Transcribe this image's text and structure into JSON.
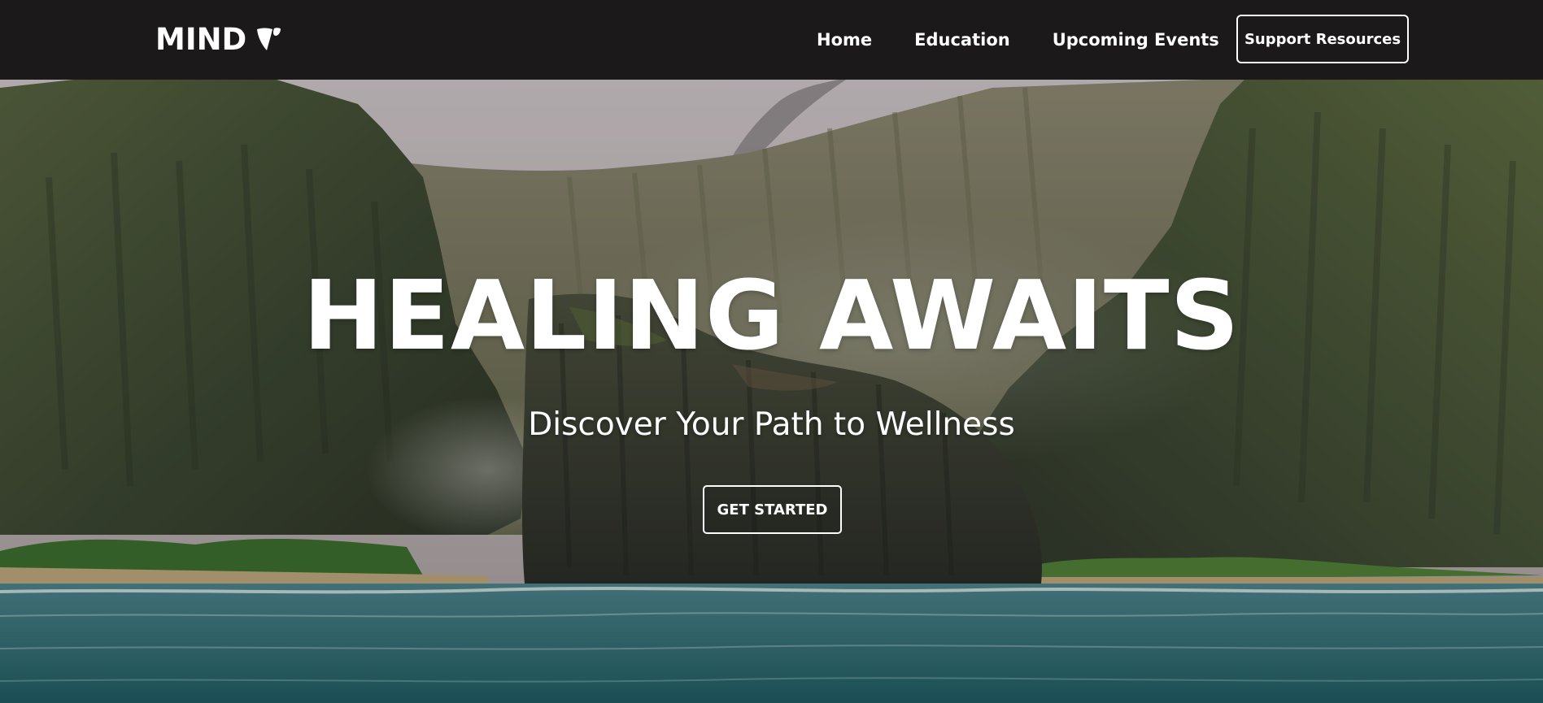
{
  "navbar": {
    "brand": {
      "text": "MIND",
      "icon": "typo3-logo-icon"
    },
    "links": [
      {
        "label": "Home"
      },
      {
        "label": "Education"
      },
      {
        "label": "Upcoming Events"
      }
    ],
    "cta_label": "Support Resources"
  },
  "hero": {
    "background": "coastal-cliffs-sea-photo",
    "title": "HEALING AWAITS",
    "subtitle": "Discover Your Path to Wellness",
    "button_label": "GET STARTED"
  },
  "colors": {
    "navbar_bg": "#1b1919",
    "text": "#ffffff",
    "sea": "#2c6b70",
    "cliff": "#3c4a34"
  }
}
